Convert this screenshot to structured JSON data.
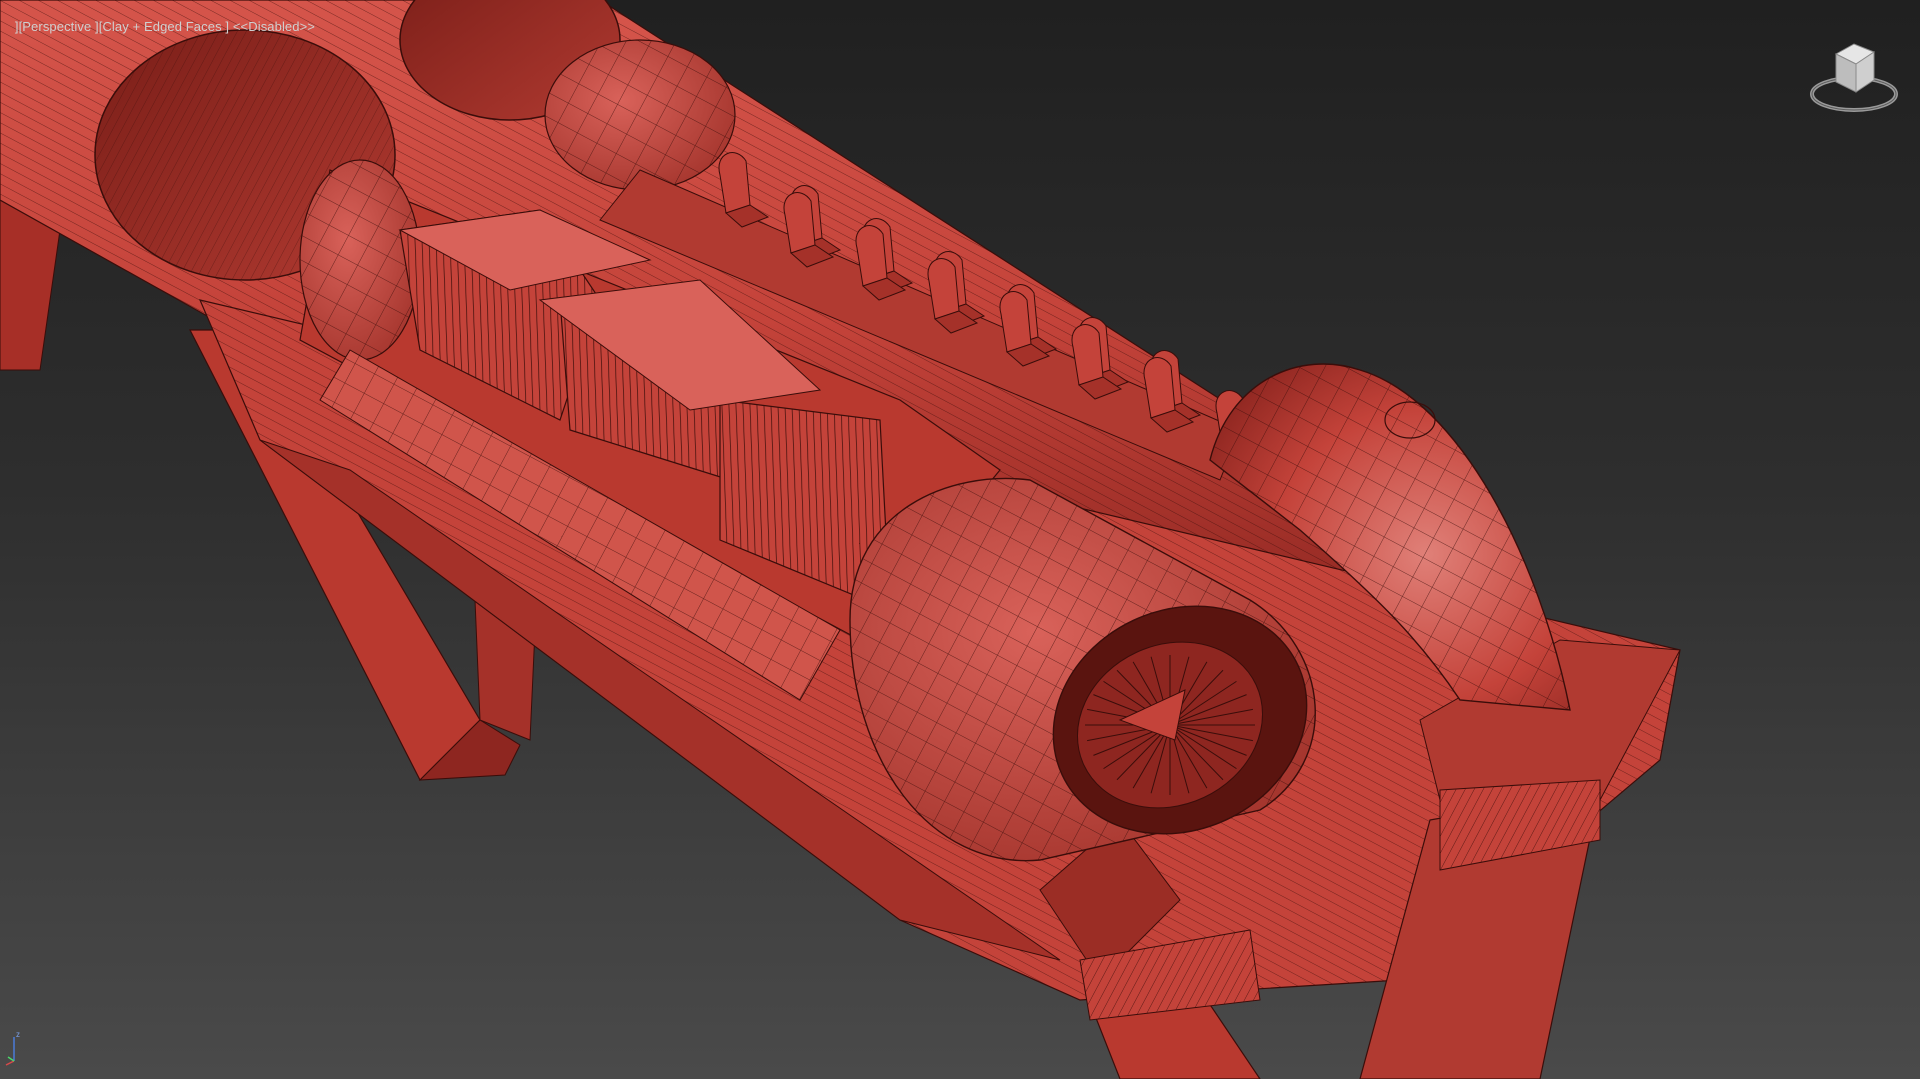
{
  "viewport": {
    "label_bracket_left": "]",
    "view_mode": "[Perspective ]",
    "shading_mode": "[Clay + Edged Faces ]",
    "status": "<<Disabled>>"
  },
  "viewcube": {
    "icon": "viewcube-icon"
  },
  "axis_tripod": {
    "icon": "axis-tripod-icon",
    "x_label": "x",
    "y_label": "y",
    "z_label": "z"
  },
  "model": {
    "description_icon": "hyperloop-pod-model",
    "clay_color": "#c4433a",
    "clay_dark": "#8e2620",
    "clay_light": "#d9625a",
    "wire_color": "#3a0d0a",
    "background_top": "#202020",
    "background_bottom": "#4a4a4a"
  }
}
